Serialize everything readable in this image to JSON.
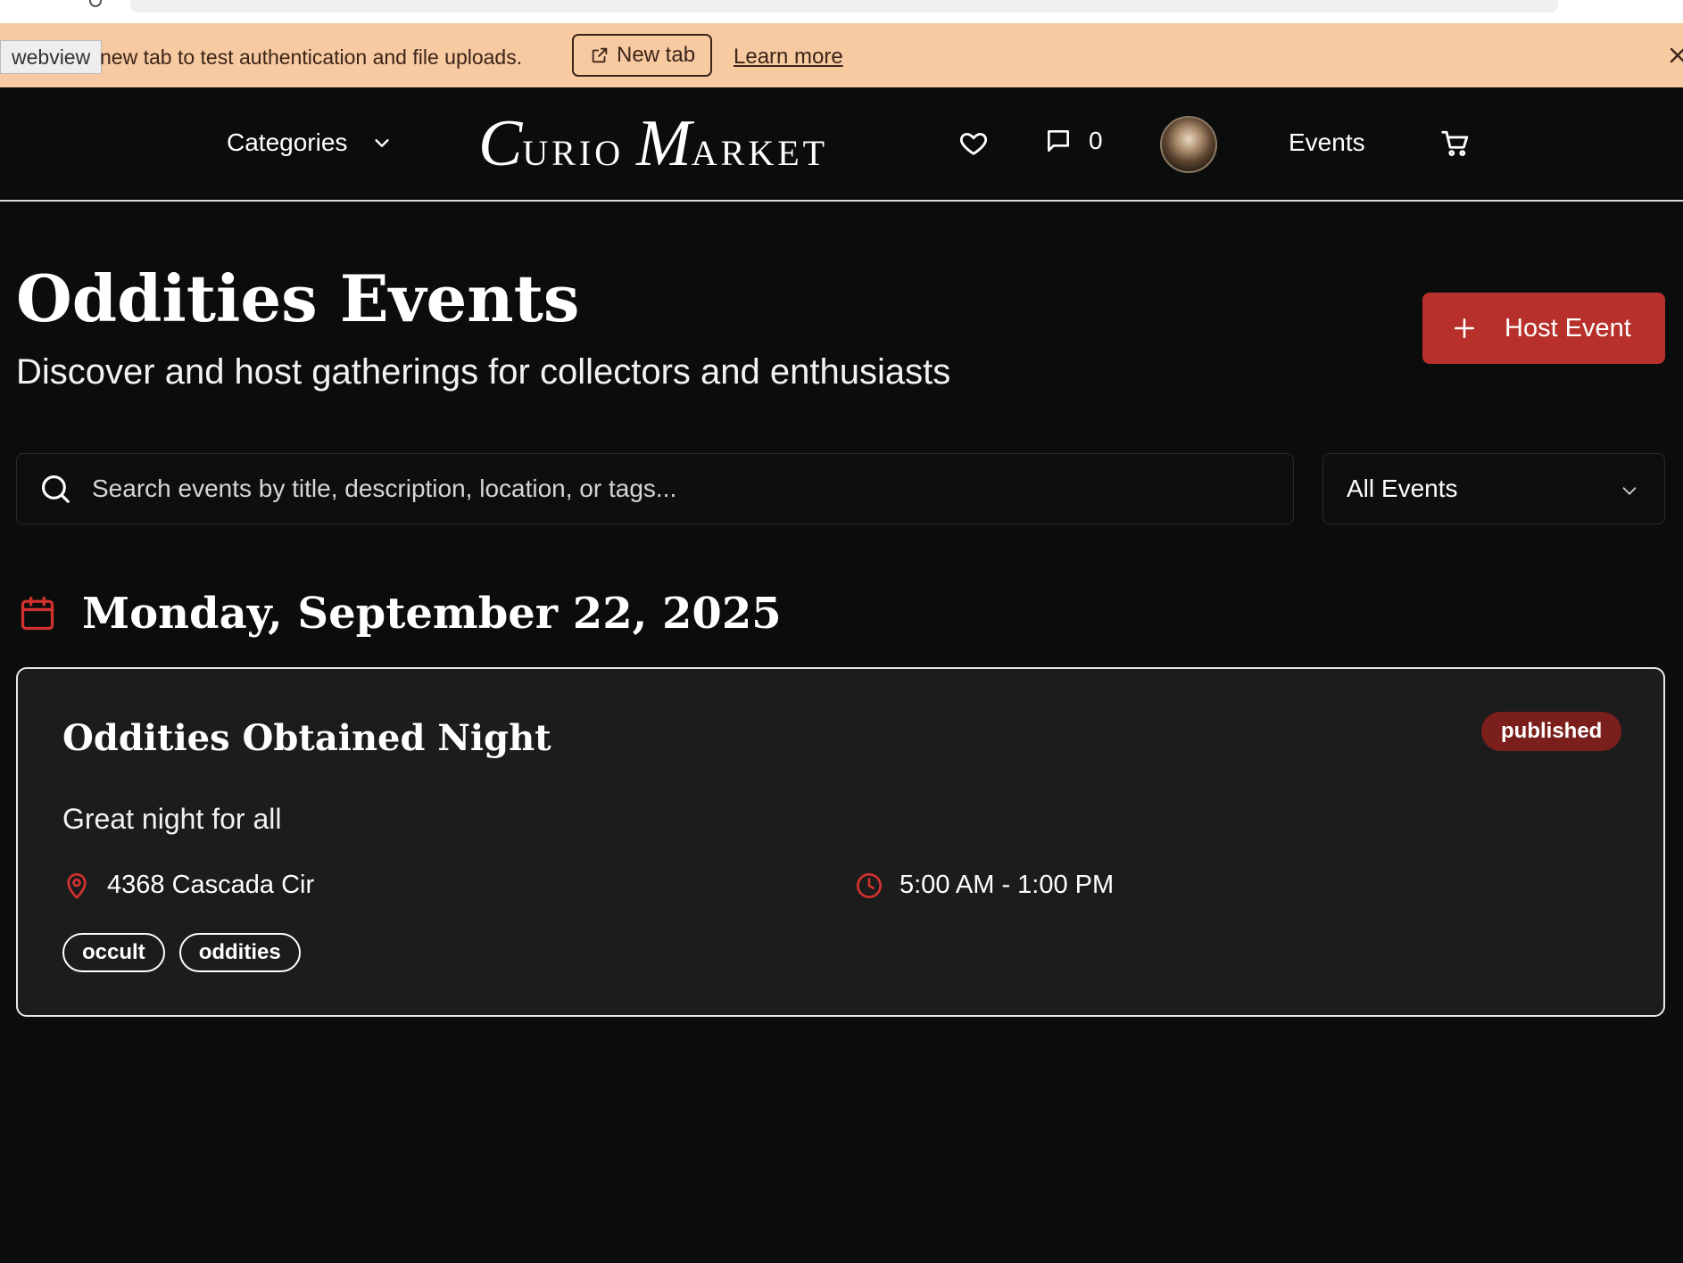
{
  "banner": {
    "chip_label": "webview",
    "message": "new tab to test authentication and file uploads.",
    "new_tab_label": "New tab",
    "learn_more_label": "Learn more"
  },
  "nav": {
    "categories_label": "Categories",
    "logo": {
      "c": "C",
      "urio": "URIO",
      "m": "M",
      "arket": "ARKET"
    },
    "message_count": "0",
    "events_label": "Events"
  },
  "page": {
    "title": "Oddities Events",
    "subtitle": "Discover and host gatherings for collectors and enthusiasts",
    "host_event_label": "Host Event",
    "search_placeholder": "Search events by title, description, location, or tags...",
    "filter_selected": "All Events"
  },
  "events_by_date": [
    {
      "date": "Monday, September 22, 2025",
      "events": [
        {
          "title": "Oddities Obtained Night",
          "status": "published",
          "description": "Great night for all",
          "location": "4368 Cascada Cir",
          "time": "5:00 AM - 1:00 PM",
          "tags": [
            "occult",
            "oddities"
          ]
        }
      ]
    }
  ],
  "colors": {
    "background": "#0b0c0c",
    "card_background": "#1c1c1d",
    "accent_red": "#b7302b",
    "badge_red": "#7a1f1c",
    "banner_background": "#f7caa2",
    "icon_red": "#d2322d"
  },
  "icons": [
    "external-link-icon",
    "close-icon",
    "chevron-down-icon",
    "heart-icon",
    "message-icon",
    "cart-icon",
    "plus-icon",
    "search-icon",
    "calendar-icon",
    "map-pin-icon",
    "clock-icon"
  ]
}
